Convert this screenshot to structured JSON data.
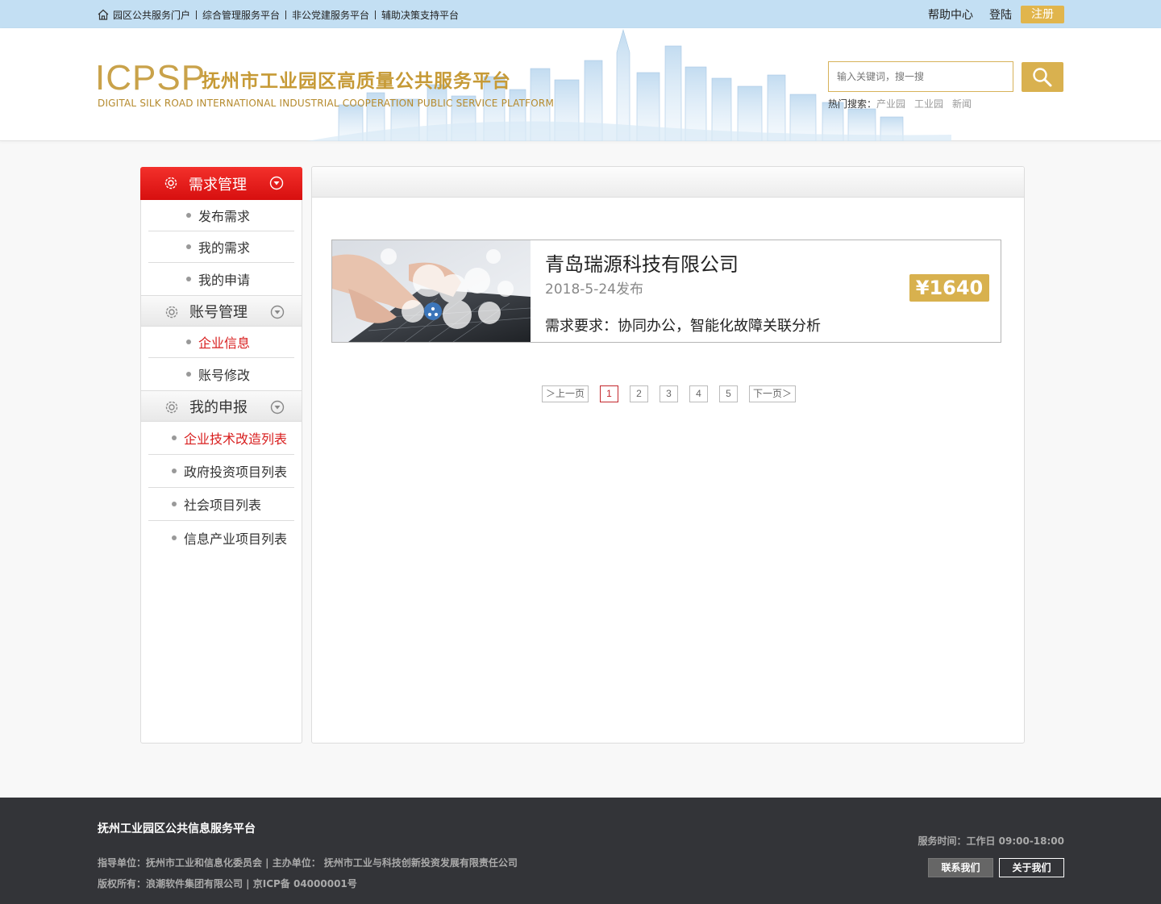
{
  "topbar": {
    "nav": [
      "园区公共服务门户",
      "综合管理服务平台",
      "非公党建服务平台",
      "辅助决策支持平台"
    ],
    "help": "帮助中心",
    "login": "登陆",
    "register": "注册"
  },
  "header": {
    "logo_mark": "ICPSP",
    "title": "抚州市工业园区高质量公共服务平台",
    "subtitle": "DIGITAL SILK ROAD INTERNATIONAL INDUSTRIAL COOPERATION PUBLIC SERVICE PLATFORM",
    "search_placeholder": "输入关键词，搜一搜",
    "hot_label": "热门搜索：",
    "hot_keywords": [
      "产业园",
      "工业园",
      "新闻"
    ]
  },
  "sidebar": {
    "groups": [
      {
        "label": "需求管理",
        "items": [
          "发布需求",
          "我的需求",
          "我的申请"
        ]
      },
      {
        "label": "账号管理",
        "items": [
          "企业信息",
          "账号修改"
        ]
      },
      {
        "label": "我的申报",
        "items": [
          "企业技术改造列表",
          "政府投资项目列表",
          "社会项目列表",
          "信息产业项目列表"
        ]
      }
    ]
  },
  "card": {
    "company": "青岛瑞源科技有限公司",
    "date": "2018-5-24发布",
    "requirement": "需求要求：协同办公，智能化故障关联分析",
    "price": "¥1640"
  },
  "pager": {
    "prev": "＞上一页",
    "pages": [
      "1",
      "2",
      "3",
      "4",
      "5"
    ],
    "next": "下一页＞"
  },
  "footer": {
    "title": "抚州工业园区公共信息服务平台",
    "line1": "指导单位：抚州市工业和信息化委员会 | 主办单位： 抚州市工业与科技创新投资发展有限责任公司",
    "line2": "版权所有：浪潮软件集团有限公司 | 京ICP备 04000001号",
    "service_time": "服务时间：工作日  09:00-18:00",
    "contact": "联系我们",
    "about": "关于我们"
  },
  "colors": {
    "accent_gold": "#d8b14e",
    "accent_red": "#d81e1e",
    "topbar": "#c3dff3",
    "footer": "#333438"
  }
}
